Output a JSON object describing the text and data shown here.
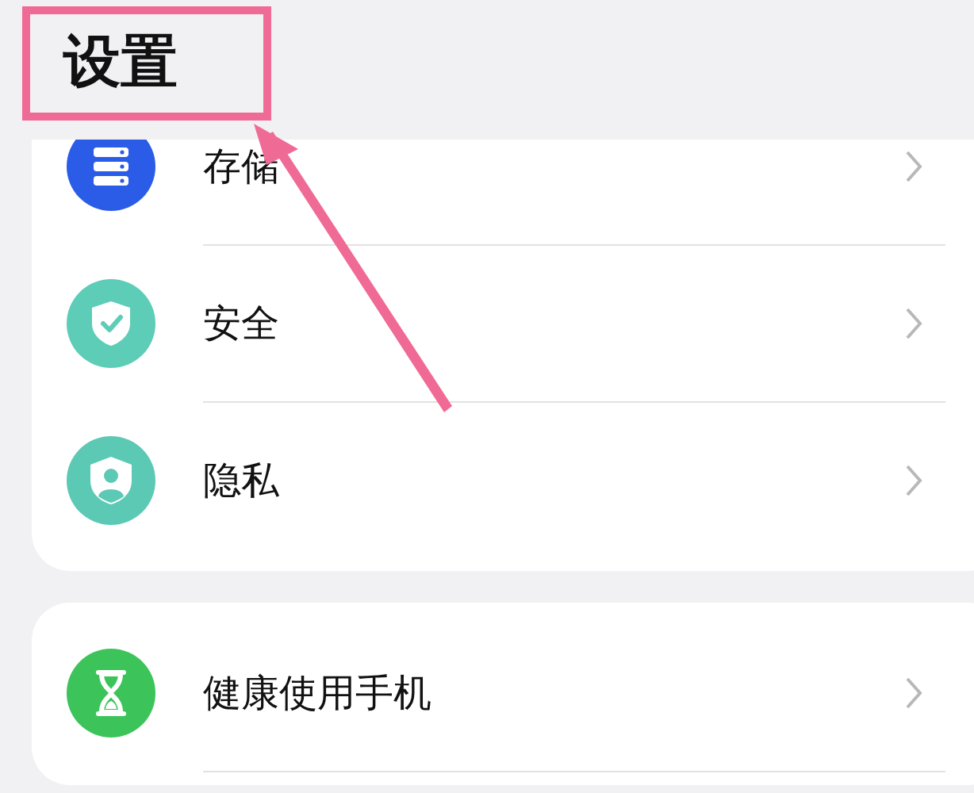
{
  "title": "设置",
  "groups": [
    {
      "items": [
        {
          "kind": "storage",
          "label": "存储"
        },
        {
          "kind": "security",
          "label": "安全"
        },
        {
          "kind": "privacy",
          "label": "隐私"
        }
      ]
    },
    {
      "items": [
        {
          "kind": "health",
          "label": "健康使用手机"
        }
      ]
    }
  ]
}
